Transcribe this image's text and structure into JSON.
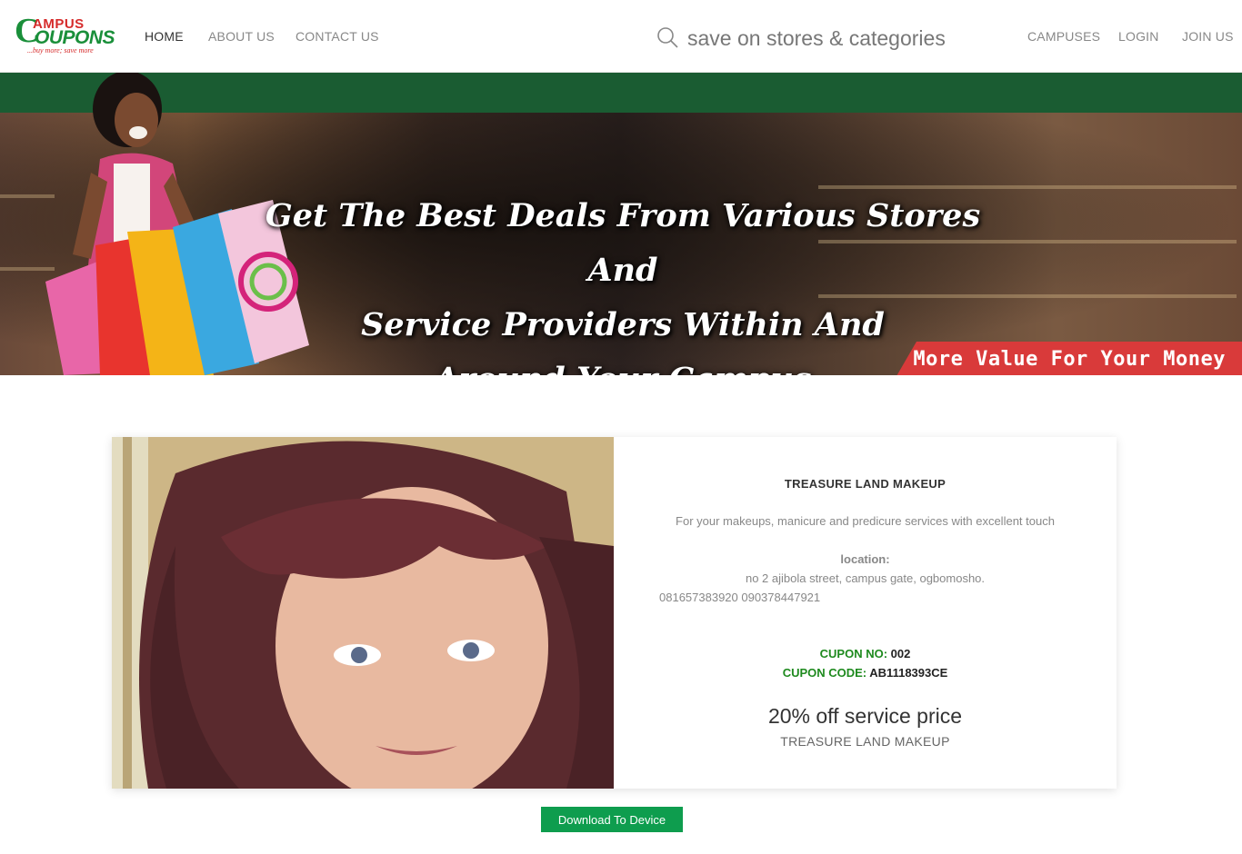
{
  "brand": {
    "logo_c": "C",
    "logo_top": "AMPUS",
    "logo_bottom": "OUPONS",
    "tagline": "...buy more; save more",
    "primary_color": "#1a8f3a",
    "accent_color": "#d62b2b"
  },
  "nav": {
    "home": "HOME",
    "about": "ABOUT US",
    "contact": "CONTACT US",
    "campuses": "CAMPUSES",
    "login": "LOGIN",
    "join": "JOIN US"
  },
  "search": {
    "placeholder": "save on stores & categories",
    "icon": "search-icon"
  },
  "banner": {
    "headline_line1": "Get The Best Deals From Various Stores And",
    "headline_line2": "Service Providers Within And",
    "headline_line3": "Around Your Campus",
    "ribbon": "Get More Value For Your Money",
    "ribbon_color": "#d93a3a"
  },
  "coupon": {
    "store_name": "TREASURE LAND MAKEUP",
    "description": "For your makeups, manicure and predicure services with excellent touch",
    "location_label": "location:",
    "address": "no 2 ajibola street, campus gate, ogbomosho.",
    "phones": "081657383920 090378447921",
    "cupon_no_label": "CUPON NO:",
    "cupon_no": "002",
    "cupon_code_label": "CUPON CODE:",
    "cupon_code": "AB1118393CE",
    "offer": "20% off service price",
    "offer_store": "TREASURE LAND MAKEUP"
  },
  "actions": {
    "download": "Download To Device",
    "download_color": "#0e9d4e"
  }
}
